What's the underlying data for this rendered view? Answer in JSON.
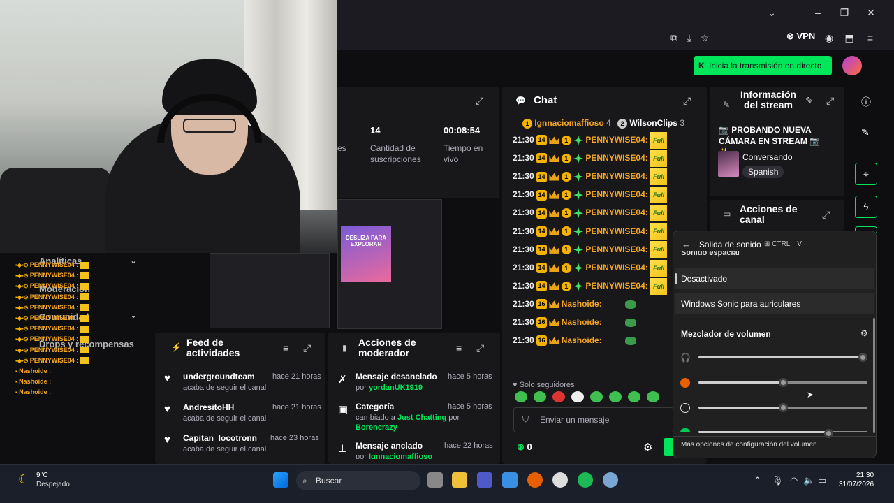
{
  "browser": {
    "vpn_label": "VPN"
  },
  "header": {
    "live_button": "Inicia la transmisión en directo"
  },
  "stats": {
    "partial_label": "es",
    "subs_value": "14",
    "subs_label": "Cantidad de suscripciones",
    "uptime_value": "00:08:54",
    "uptime_label": "Tiempo en vivo"
  },
  "mini_screens": {
    "promo_text": "DESLIZA PARA EXPLORAR"
  },
  "overlay_menu": {
    "analytics": "Analíticas",
    "moderation": "Moderación",
    "community": "Comunidad",
    "drops": "Drops y recompensas"
  },
  "mini_chat": {
    "lines": [
      "PENNYWISE04 :",
      "PENNYWISE04 :",
      "PENNYWISE04 :",
      "PENNYWISE04 :",
      "PENNYWISE04 :",
      "PENNYWISE04 :",
      "PENNYWISE04 :",
      "PENNYWISE04 :",
      "PENNYWISE04 :",
      "PENNYWISE04 :",
      "Nashoide :",
      "Nashoide :",
      "Nashoide :"
    ]
  },
  "feed": {
    "title": "Feed de actividades",
    "items": [
      {
        "name": "undergroundteam",
        "sub": "acaba de seguir el canal",
        "time": "hace 21 horas"
      },
      {
        "name": "AndresitoHH",
        "sub": "acaba de seguir el canal",
        "time": "hace 21 horas"
      },
      {
        "name": "Capitan_locotronn",
        "sub": "acaba de seguir el canal",
        "time": "hace 23 horas"
      }
    ]
  },
  "mod": {
    "title": "Acciones de moderador",
    "items": [
      {
        "title": "Mensaje desanclado",
        "by": "por",
        "user": "yordanUK1919",
        "time": "hace 5 horas"
      },
      {
        "title": "Categoría",
        "by": "cambiado a",
        "user": "Just Chatting",
        "by2": "por",
        "user2": "Borencrazy",
        "time": "hace 5 horas"
      },
      {
        "title": "Mensaje anclado",
        "by": "por",
        "user": "Ignnaciomaffioso",
        "time": "hace 22 horas"
      }
    ]
  },
  "chat": {
    "title": "Chat",
    "top_user1": "Ignnaciomaffioso",
    "top_count1": "4",
    "top_user2": "WilsonClips",
    "top_count2": "3",
    "rows": [
      {
        "time": "21:30",
        "sub": "14",
        "user": "PENNYWISE04:"
      },
      {
        "time": "21:30",
        "sub": "14",
        "user": "PENNYWISE04:"
      },
      {
        "time": "21:30",
        "sub": "14",
        "user": "PENNYWISE04:"
      },
      {
        "time": "21:30",
        "sub": "14",
        "user": "PENNYWISE04:"
      },
      {
        "time": "21:30",
        "sub": "14",
        "user": "PENNYWISE04:"
      },
      {
        "time": "21:30",
        "sub": "14",
        "user": "PENNYWISE04:"
      },
      {
        "time": "21:30",
        "sub": "14",
        "user": "PENNYWISE04:"
      },
      {
        "time": "21:30",
        "sub": "14",
        "user": "PENNYWISE04:"
      },
      {
        "time": "21:30",
        "sub": "14",
        "user": "PENNYWISE04:"
      },
      {
        "time": "21:30",
        "sub": "16",
        "user": "Nashoide:"
      },
      {
        "time": "21:30",
        "sub": "16",
        "user": "Nashoide:"
      },
      {
        "time": "21:30",
        "sub": "16",
        "user": "Nashoide:"
      }
    ],
    "emote_label": "Full",
    "followers_only": "Solo seguidores",
    "input_placeholder": "Enviar un mensaje",
    "points": "0"
  },
  "stream_info": {
    "title": "Información del stream",
    "stream_title": "📷 PROBANDO NUEVA CÁMARA EN STREAM 📷 ✨...",
    "category": "Conversando",
    "language": "Spanish"
  },
  "channel_actions": {
    "title": "Acciones de canal"
  },
  "sound_popup": {
    "title": "Salida de sonido",
    "shortcut_mod": "CTRL",
    "shortcut_key": "V",
    "spatial": "Sonido espacial",
    "option_off": "Desactivado",
    "option_sonic": "Windows Sonic para auriculares",
    "mixer": "Mezclador de volumen",
    "more": "Más opciones de configuración del volumen",
    "sliders": [
      {
        "icon": "headphones-icon",
        "level": 0.97
      },
      {
        "icon": "firefox-icon",
        "level": 0.5
      },
      {
        "icon": "chrome-icon",
        "level": 0.5
      },
      {
        "icon": "app-icon",
        "level": 0.77
      }
    ]
  },
  "taskbar": {
    "temp": "9°C",
    "weather": "Despejado",
    "search": "Buscar",
    "time": "21:30",
    "date": "31/07/2026"
  },
  "colors": {
    "accent": "#00e65b",
    "subgold": "#f5a623"
  }
}
